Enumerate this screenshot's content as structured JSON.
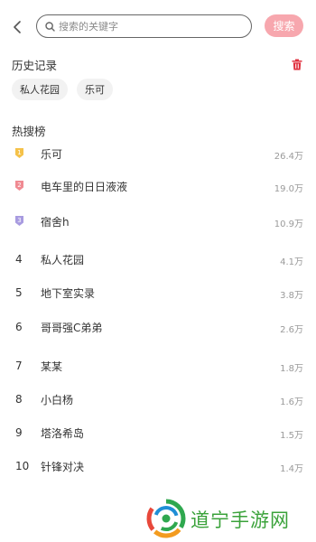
{
  "search": {
    "back_icon": "chevron-left-icon",
    "search_icon": "search-icon",
    "placeholder": "搜索的关键字",
    "button_label": "搜索",
    "accent_color": "#f7a7ae"
  },
  "history": {
    "title": "历史记录",
    "clear_icon": "trash-icon",
    "clear_color": "#e0313f",
    "tags": [
      "私人花园",
      "乐可"
    ]
  },
  "hot": {
    "title": "热搜榜",
    "badge_colors": [
      "#f5c24a",
      "#f08a92",
      "#a89be0"
    ],
    "items": [
      {
        "rank": "1",
        "label": "乐可",
        "count": "26.4万"
      },
      {
        "rank": "2",
        "label": "电车里的日日液液",
        "count": "19.0万"
      },
      {
        "rank": "3",
        "label": "宿舍h",
        "count": "10.9万"
      },
      {
        "rank": "4",
        "label": "私人花园",
        "count": "4.1万"
      },
      {
        "rank": "5",
        "label": "地下室实录",
        "count": "3.8万"
      },
      {
        "rank": "6",
        "label": "哥哥强C弟弟",
        "count": "2.6万"
      },
      {
        "rank": "7",
        "label": "某某",
        "count": "1.8万"
      },
      {
        "rank": "8",
        "label": "小白杨",
        "count": "1.6万"
      },
      {
        "rank": "9",
        "label": "塔洛希岛",
        "count": "1.5万"
      },
      {
        "rank": "10",
        "label": "针锋对决",
        "count": "1.4万"
      }
    ]
  },
  "watermark": {
    "text": "道宁手游网"
  }
}
